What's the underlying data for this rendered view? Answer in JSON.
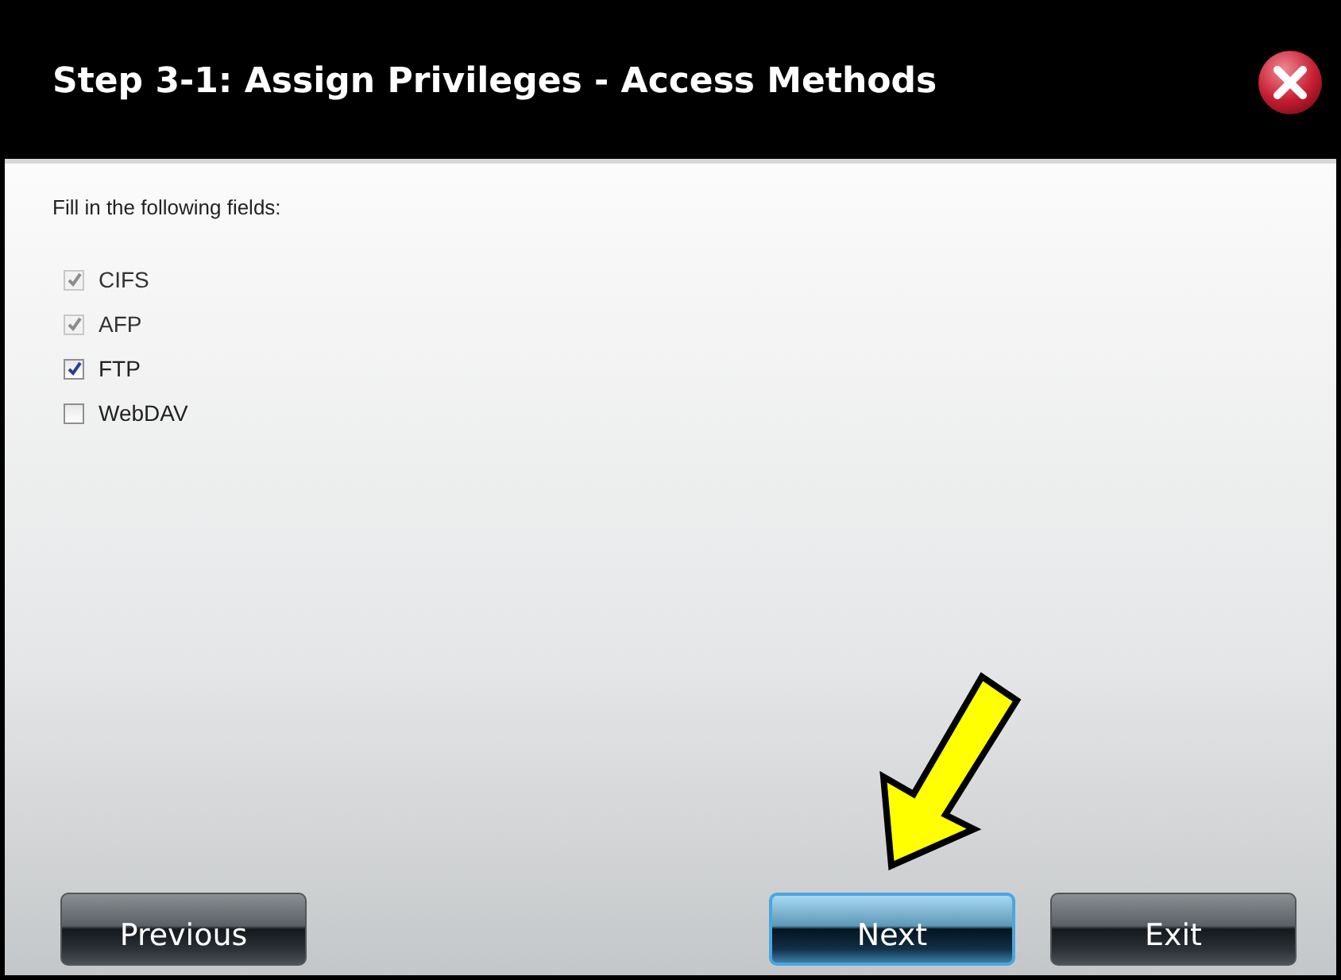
{
  "window": {
    "title": "Step 3-1: Assign Privileges - Access Methods"
  },
  "instruction": "Fill in the following fields:",
  "options": [
    {
      "label": "CIFS",
      "checked": true,
      "disabled": true
    },
    {
      "label": "AFP",
      "checked": true,
      "disabled": true
    },
    {
      "label": "FTP",
      "checked": true,
      "disabled": false
    },
    {
      "label": "WebDAV",
      "checked": false,
      "disabled": false
    }
  ],
  "buttons": [
    {
      "label": "Previous",
      "selected": false
    },
    {
      "label": "Next",
      "selected": true
    },
    {
      "label": "Exit",
      "selected": false
    }
  ]
}
